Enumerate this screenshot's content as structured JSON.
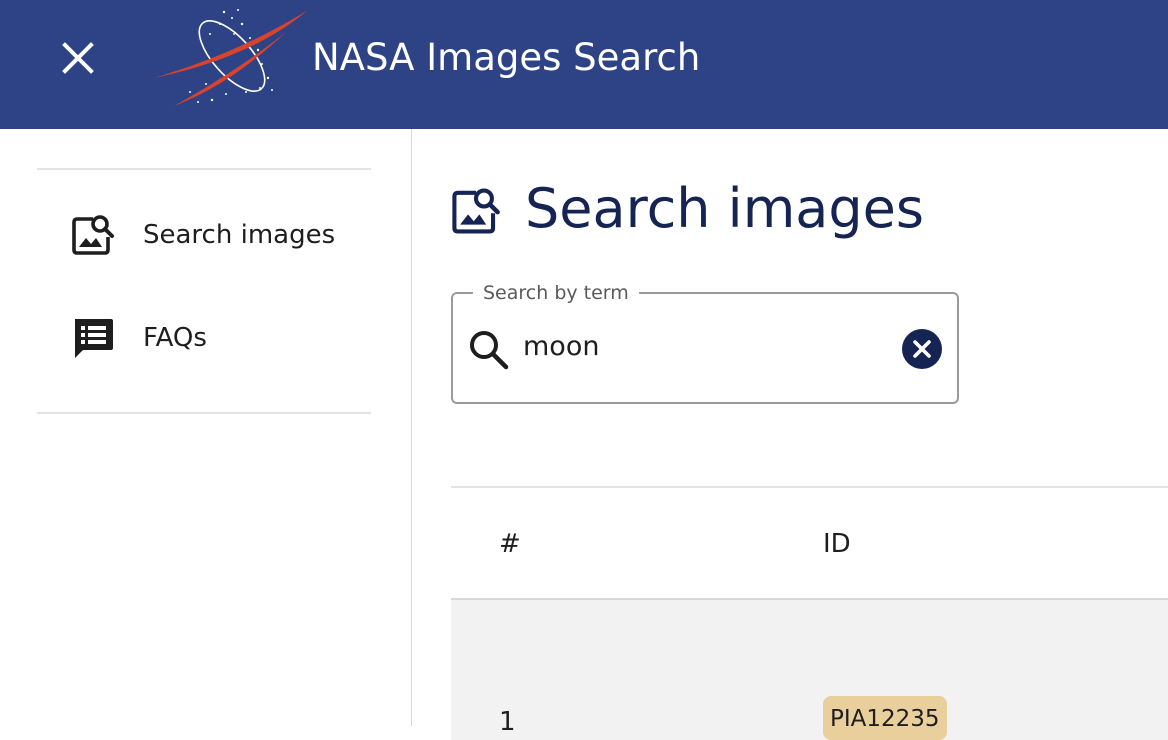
{
  "header": {
    "title": "NASA Images Search",
    "close_icon": "close-icon",
    "logo": "nasa-swoosh-logo",
    "background": "#2d4385"
  },
  "sidebar": {
    "items": [
      {
        "label": "Search images",
        "icon": "image-search-icon"
      },
      {
        "label": "FAQs",
        "icon": "chat-list-icon"
      }
    ]
  },
  "main": {
    "title": "Search images",
    "title_icon": "image-search-icon",
    "title_color": "#162454",
    "search": {
      "legend": "Search by term",
      "value": "moon",
      "search_icon": "search-icon",
      "clear_icon": "clear-circle-icon"
    },
    "table": {
      "columns": [
        "#",
        "ID"
      ],
      "rows": [
        {
          "index": "1",
          "id": "PIA12235"
        }
      ],
      "chip_color": "#e8cf9c"
    }
  }
}
